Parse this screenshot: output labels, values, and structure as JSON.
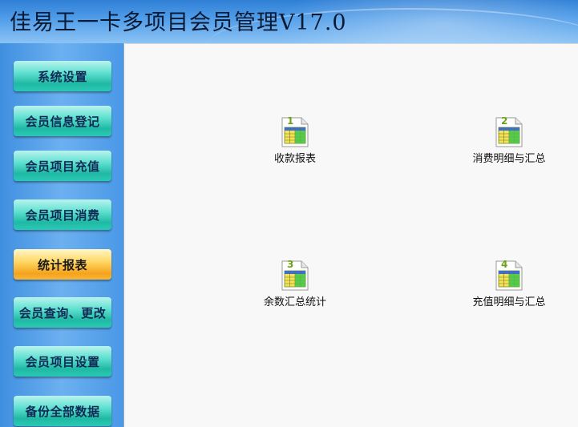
{
  "header": {
    "title": "佳易王一卡多项目会员管理V17.0"
  },
  "sidebar": {
    "items": [
      {
        "label": "系统设置"
      },
      {
        "label": "会员信息登记"
      },
      {
        "label": "会员项目充值"
      },
      {
        "label": "会员项目消费"
      },
      {
        "label": "统计报表",
        "active": true
      },
      {
        "label": "会员查询、更改"
      },
      {
        "label": "会员项目设置"
      },
      {
        "label": "备份全部数据"
      }
    ]
  },
  "main": {
    "reports": [
      {
        "number": "1",
        "label": "收款报表",
        "icon": "spreadsheet-icon"
      },
      {
        "number": "2",
        "label": "消费明细与汇总",
        "icon": "spreadsheet-icon"
      },
      {
        "number": "3",
        "label": "余数汇总统计",
        "icon": "spreadsheet-icon"
      },
      {
        "number": "4",
        "label": "充值明细与汇总",
        "icon": "spreadsheet-icon"
      }
    ]
  },
  "colors": {
    "header": "#4d9be8",
    "sidebar": "#5aa6ec",
    "button": "#3fd0bc",
    "button_active": "#f5a21c",
    "content_bg": "#f8f8f8"
  }
}
